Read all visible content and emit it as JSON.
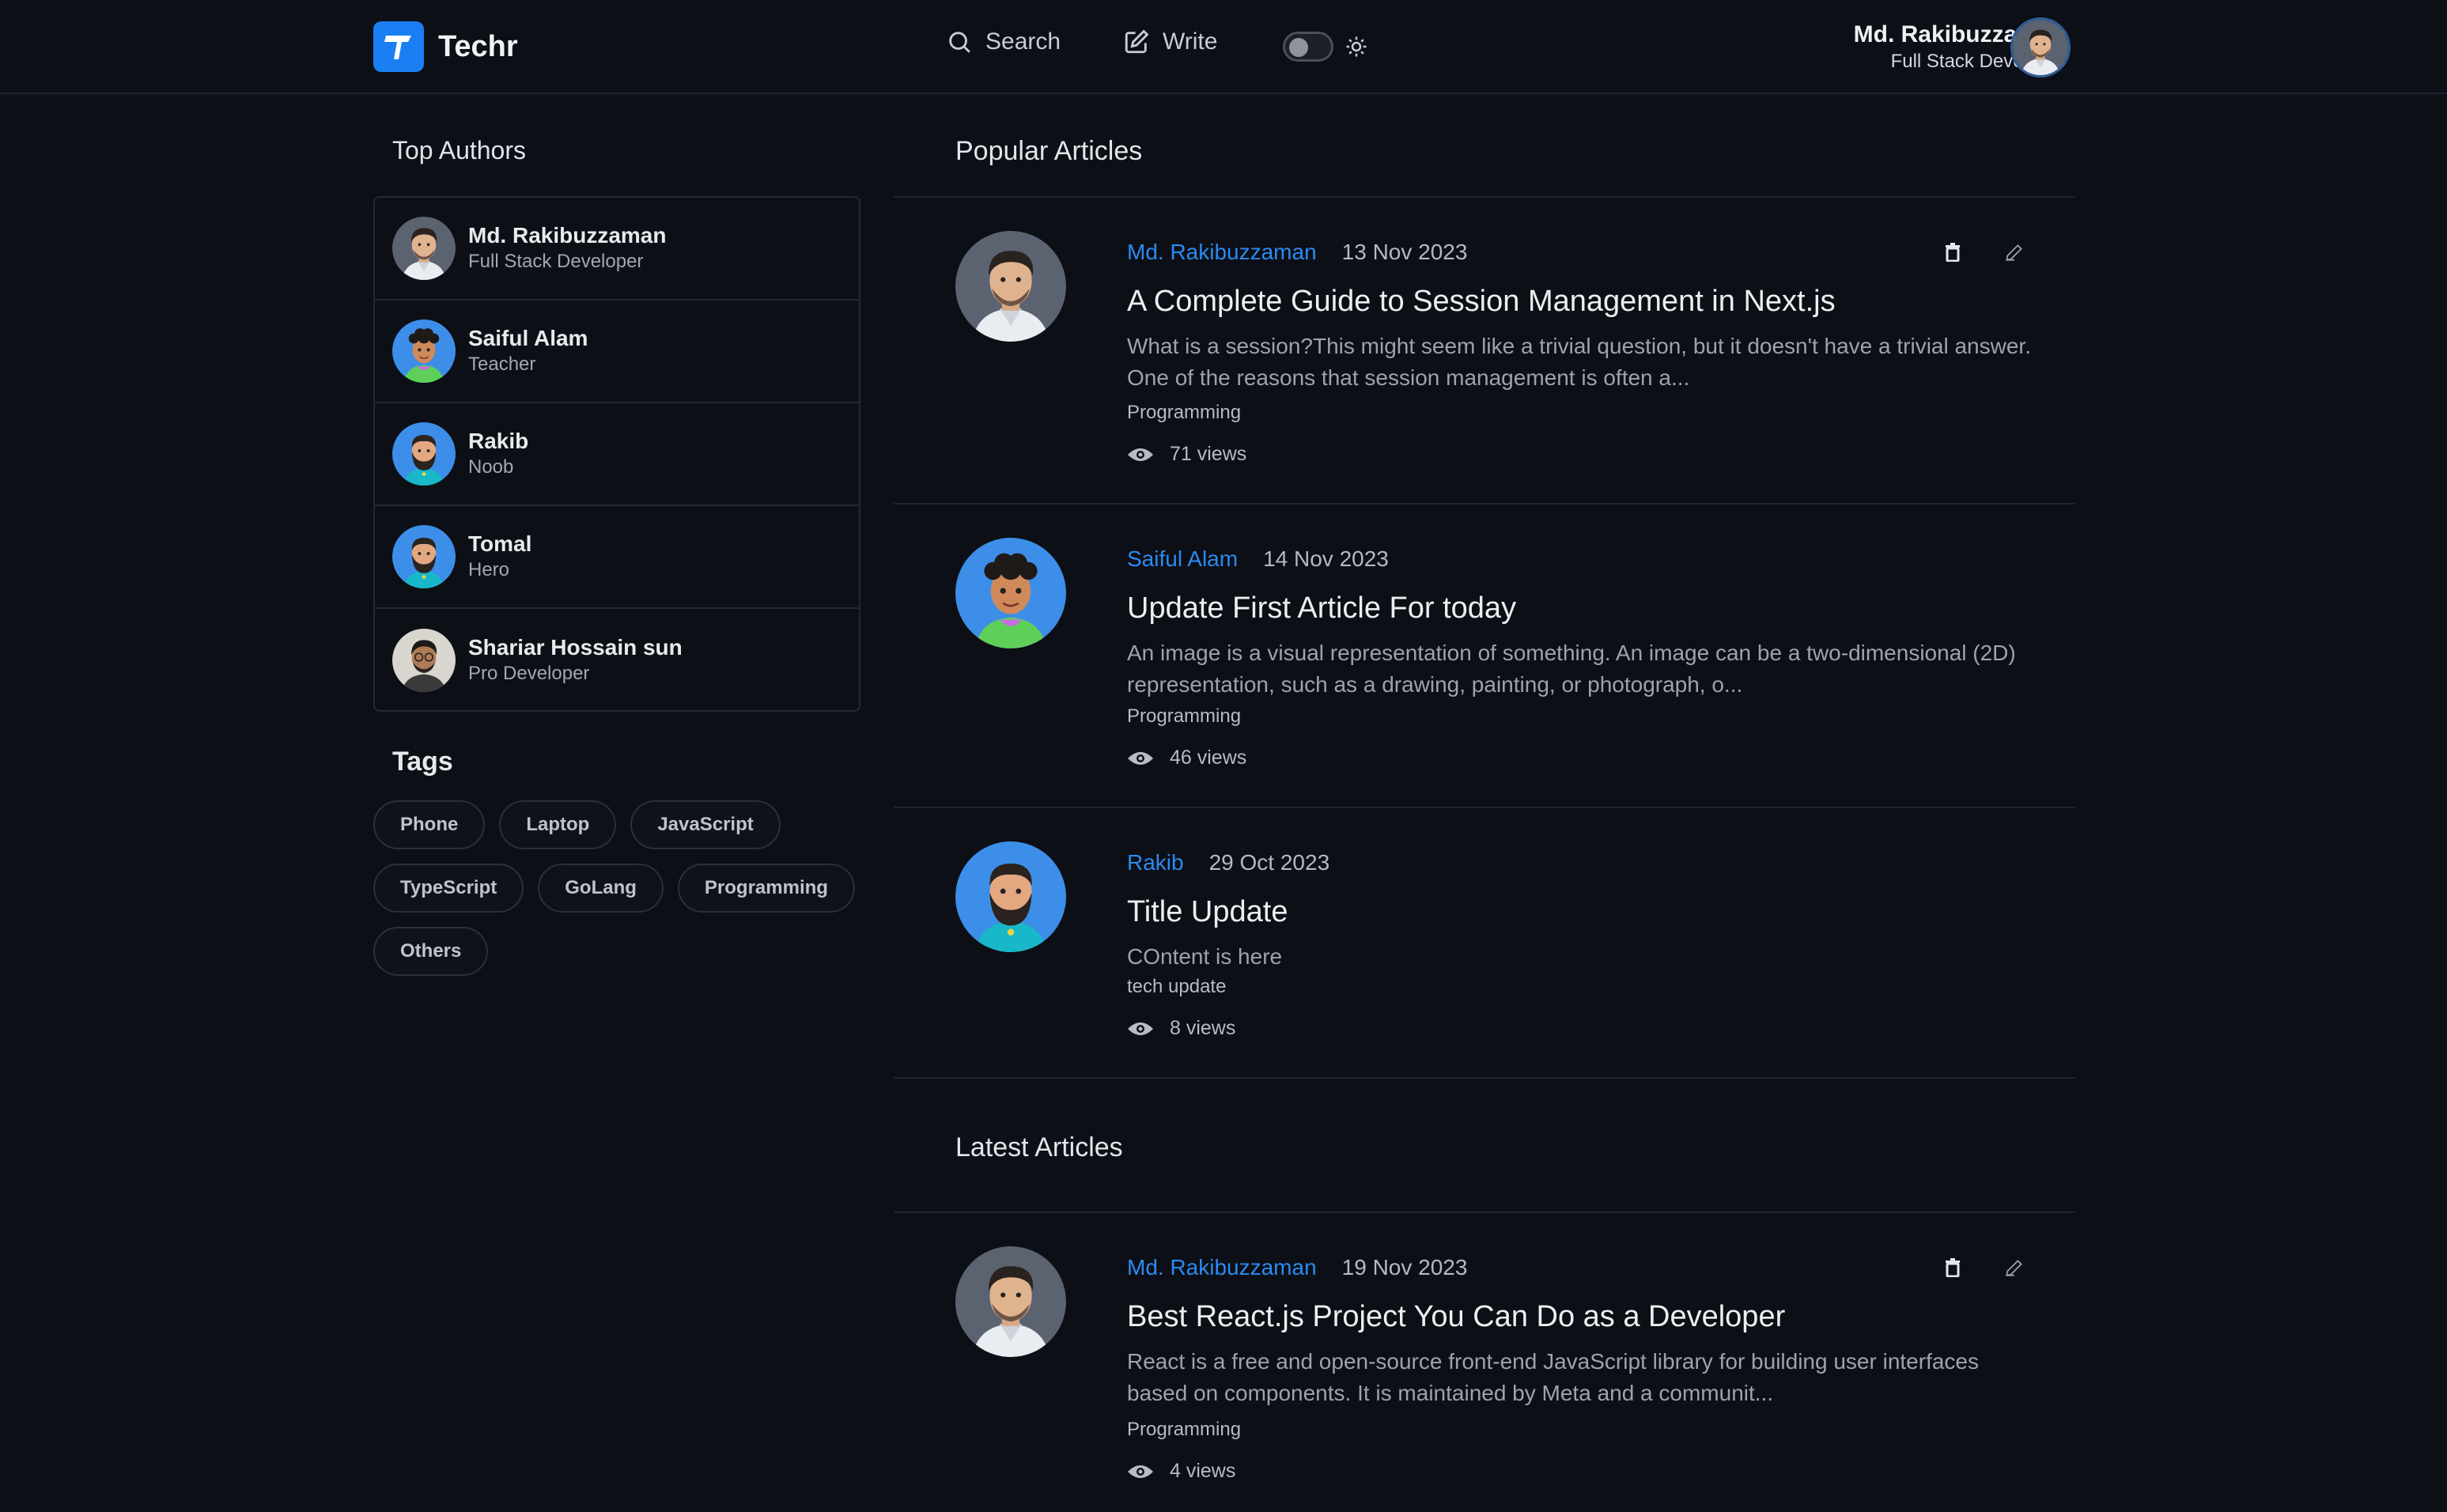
{
  "brand": {
    "name": "Techr",
    "accent": "#1a7ff2"
  },
  "nav": {
    "search_label": "Search",
    "write_label": "Write",
    "theme_toggle": "dark"
  },
  "user": {
    "name": "Md. Rakibuzzaman",
    "role": "Full Stack Developer"
  },
  "sidebar": {
    "top_authors_title": "Top Authors",
    "authors": [
      {
        "name": "Md. Rakibuzzaman",
        "role": "Full Stack Developer"
      },
      {
        "name": "Saiful Alam",
        "role": "Teacher"
      },
      {
        "name": "Rakib",
        "role": "Noob"
      },
      {
        "name": "Tomal",
        "role": "Hero"
      },
      {
        "name": "Shariar Hossain sun",
        "role": "Pro Developer"
      }
    ],
    "tags_title": "Tags",
    "tags": [
      "Phone",
      "Laptop",
      "JavaScript",
      "TypeScript",
      "GoLang",
      "Programming",
      "Others"
    ]
  },
  "popular": {
    "title": "Popular Articles",
    "articles": [
      {
        "author": "Md. Rakibuzzaman",
        "date": "13 Nov 2023",
        "title": "A Complete Guide to Session Management in Next.js",
        "excerpt": "What is a session?This might seem like a trivial question, but it doesn't have a trivial answer. One of the reasons that session management is often a...",
        "category": "Programming",
        "views": "71 views"
      },
      {
        "author": "Saiful Alam",
        "date": "14 Nov 2023",
        "title": "Update First Article For today",
        "excerpt": "An image is a visual representation of something. An image can be a two-dimensional (2D) representation, such as a drawing, painting, or photograph, o...",
        "category": "Programming",
        "views": "46 views"
      },
      {
        "author": "Rakib",
        "date": "29 Oct 2023",
        "title": "Title Update",
        "excerpt": "COntent is here",
        "category": "tech update",
        "views": "8 views"
      }
    ]
  },
  "latest": {
    "title": "Latest Articles",
    "articles": [
      {
        "author": "Md. Rakibuzzaman",
        "date": "19 Nov 2023",
        "title": "Best React.js Project You Can Do as a Developer",
        "excerpt": "React is a free and open-source front-end JavaScript library for building user interfaces based on components. It is maintained by Meta and a communit...",
        "category": "Programming",
        "views": "4 views"
      }
    ]
  }
}
